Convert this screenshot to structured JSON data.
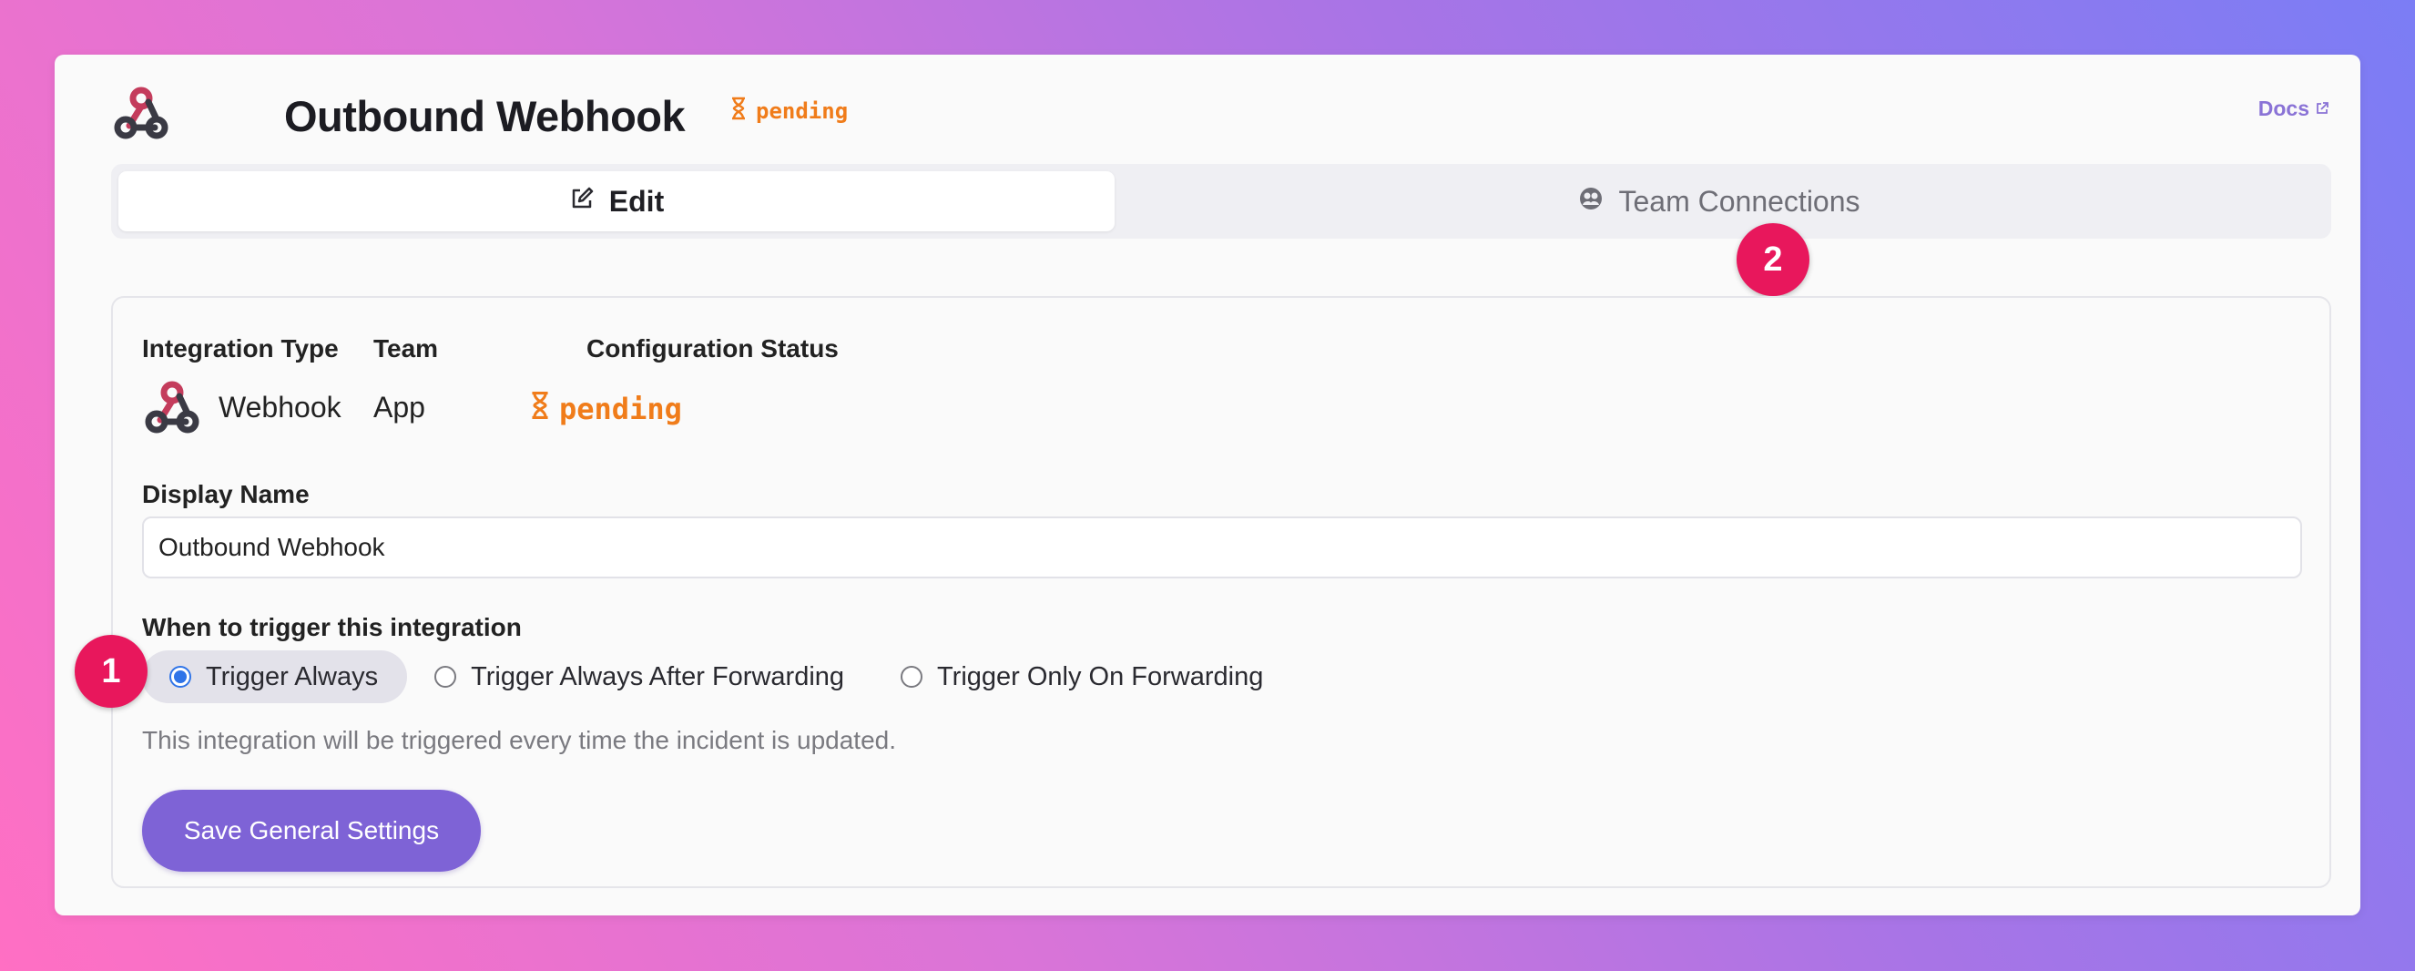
{
  "header": {
    "title": "Outbound Webhook",
    "status": "pending",
    "docs_label": "Docs"
  },
  "tabs": [
    {
      "label": "Edit",
      "active": true
    },
    {
      "label": "Team Connections",
      "active": false
    }
  ],
  "badges": [
    "1",
    "2"
  ],
  "details": {
    "integration_type_label": "Integration Type",
    "integration_type_value": "Webhook",
    "team_label": "Team",
    "team_value": "App",
    "config_status_label": "Configuration Status",
    "config_status_value": "pending"
  },
  "display_name": {
    "label": "Display Name",
    "value": "Outbound Webhook"
  },
  "trigger": {
    "label": "When to trigger this integration",
    "options": [
      {
        "label": "Trigger Always",
        "selected": true
      },
      {
        "label": "Trigger Always After Forwarding",
        "selected": false
      },
      {
        "label": "Trigger Only On Forwarding",
        "selected": false
      }
    ],
    "help": "This integration will be triggered every time the incident is updated."
  },
  "save_button": "Save General Settings",
  "colors": {
    "accent": "#7e63d6",
    "pending": "#f07c1a",
    "badge": "#e8175c",
    "radio_selected": "#2f74e8"
  }
}
